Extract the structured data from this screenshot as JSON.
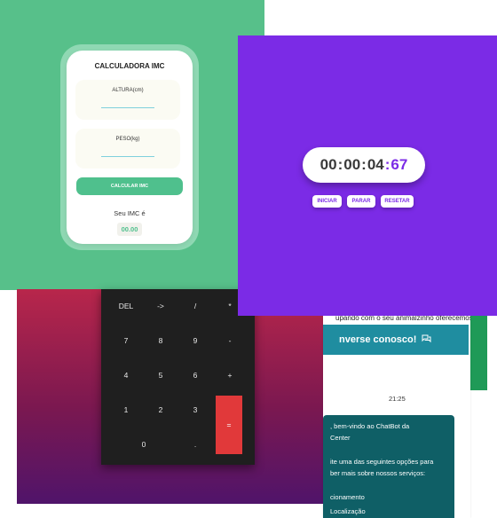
{
  "imc": {
    "title": "CALCULADORA IMC",
    "height_label": "ALTURA(cm)",
    "weight_label": "PESO(kg)",
    "button_label": "CALCULAR IMC",
    "result_label": "Seu IMC é",
    "result_value": "00.00",
    "colors": {
      "background": "#57c08a",
      "button": "#4fc08d"
    }
  },
  "calculator": {
    "keys": [
      "DEL",
      "->",
      "/",
      "*",
      "7",
      "8",
      "9",
      "-",
      "4",
      "5",
      "6",
      "+",
      "1",
      "2",
      "3",
      "=",
      "0",
      "."
    ],
    "colors": {
      "body": "#1f1f1f",
      "equals": "#e1393a"
    }
  },
  "chatbot": {
    "intro_text": "upando com o seu animalzinho oferecemos",
    "header": "nverse conosco!",
    "header_icon": "chat-icon",
    "time": "21:25",
    "greeting_line1": ", bem-vindo ao ChatBot da",
    "greeting_line2": "Center",
    "prompt_line1": "ite uma das seguintes opções para",
    "prompt_line2": "ber mais sobre nossos serviços:",
    "option1": "cionamento",
    "option2": "Localização",
    "colors": {
      "header": "#1f8da0",
      "bubble": "#0f5f66"
    }
  },
  "stopwatch": {
    "hours": "00",
    "minutes": "00",
    "seconds": "04",
    "milliseconds": "67",
    "sep": ":",
    "start_label": "INICIAR",
    "stop_label": "PARAR",
    "reset_label": "RESETAR",
    "colors": {
      "background": "#7b2be6"
    }
  }
}
